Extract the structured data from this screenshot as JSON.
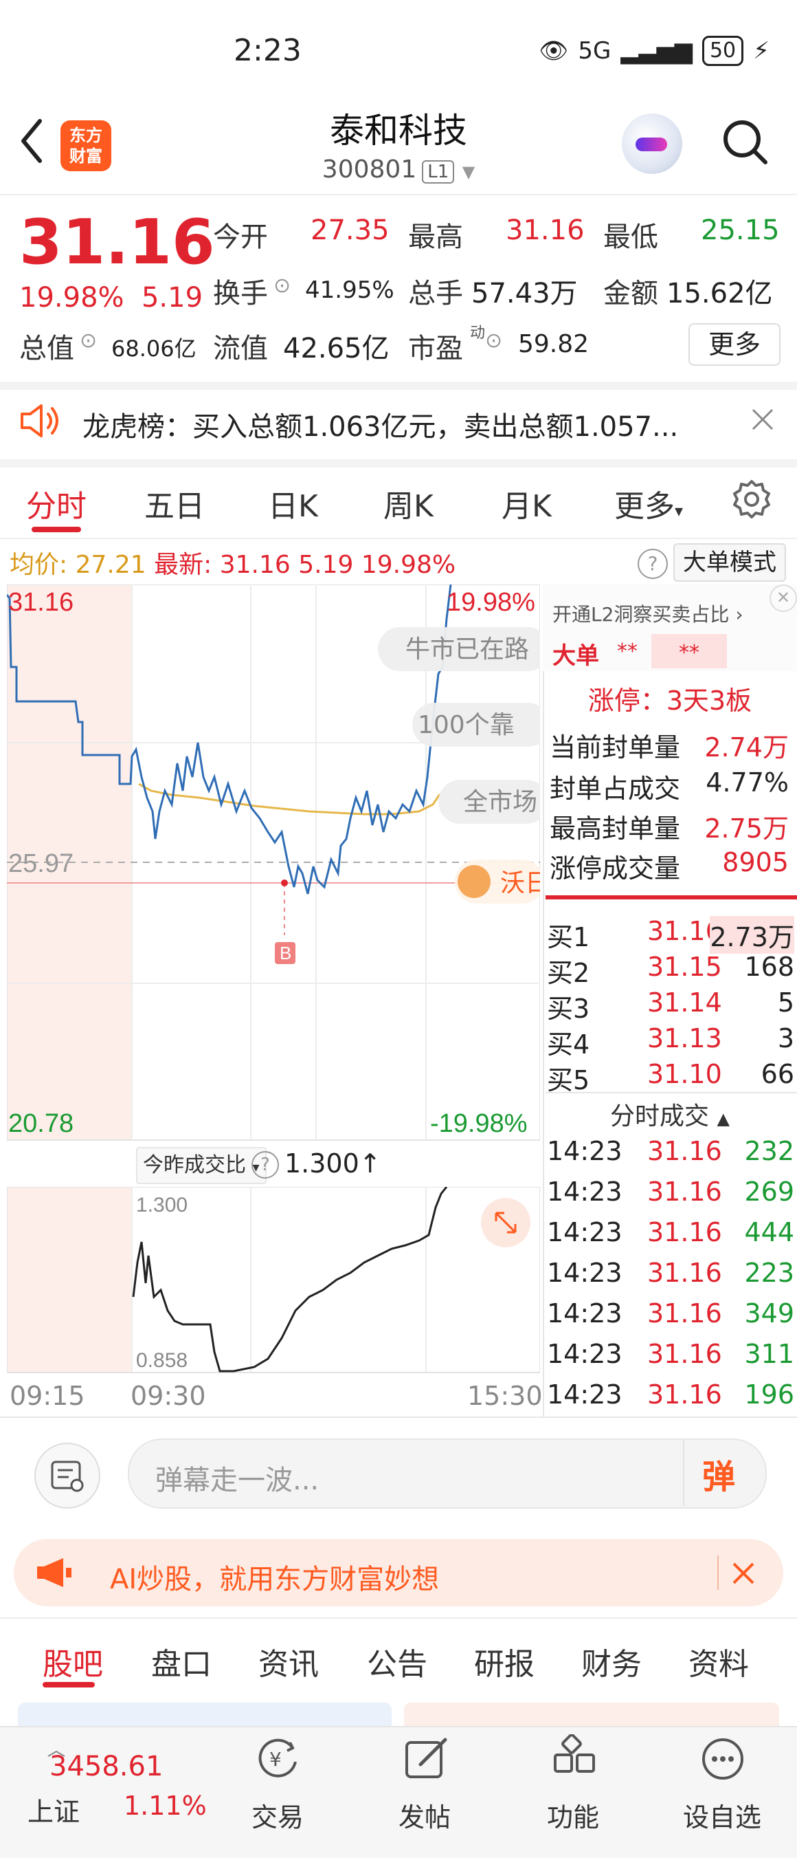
{
  "status_bar": {
    "time": "2:23",
    "signal": "5G",
    "battery": "50"
  },
  "header": {
    "logo_line1": "东方",
    "logo_line2": "财富",
    "stock_name": "泰和科技",
    "stock_code": "300801",
    "level_badge": "L1"
  },
  "quote": {
    "price": "31.16",
    "change_pct": "19.98%",
    "change_amt": "5.19",
    "open_label": "今开",
    "open_value": "27.35",
    "high_label": "最高",
    "high_value": "31.16",
    "low_label": "最低",
    "low_value": "25.15",
    "turnover_label": "换手",
    "turnover_value": "41.95%",
    "volume_label": "总手",
    "volume_value": "57.43万",
    "amount_label": "金额",
    "amount_value": "15.62亿",
    "mcap_label": "总值",
    "mcap_value": "68.06亿",
    "float_label": "流值",
    "float_value": "42.65亿",
    "pe_label": "市盈",
    "pe_sup": "动",
    "pe_value": "59.82",
    "more_label": "更多"
  },
  "notice": {
    "text": "龙虎榜：买入总额1.063亿元，卖出总额1.057..."
  },
  "chart_tabs": [
    "分时",
    "五日",
    "日K",
    "周K",
    "月K",
    "更多"
  ],
  "info_row": {
    "avg_label": "均价:",
    "avg_value": "27.21",
    "latest_label": "最新:",
    "latest_value": "31.16",
    "latest_chg": "5.19",
    "latest_pct": "19.98%",
    "big_order_mode": "大单模式"
  },
  "intraday": {
    "top_price": "31.16",
    "top_pct": "19.98%",
    "prev_close": "25.97",
    "bottom_price": "20.78",
    "bottom_pct": "-19.98%",
    "b_marker": "B",
    "floating_msgs": [
      "牛市已在路",
      "100个靠",
      "全市场",
      "沃日"
    ],
    "indicator_label": "今昨成交比",
    "indicator_value": "1.300↑",
    "ind_top": "1.300",
    "ind_bottom": "0.858",
    "time_labels": [
      "09:15",
      "09:30",
      "15:30"
    ]
  },
  "orderbook": {
    "l2_promo": "开通L2洞察买卖占比",
    "big_order_label": "大单",
    "masked_a": "**",
    "masked_b": "**",
    "limit_title": "涨停：3天3板",
    "stats": [
      {
        "label": "当前封单量",
        "value": "2.74万"
      },
      {
        "label": "封单占成交",
        "value": "4.77%"
      },
      {
        "label": "最高封单量",
        "value": "2.75万"
      },
      {
        "label": "涨停成交量",
        "value": "8905"
      }
    ],
    "bids": [
      {
        "label": "买1",
        "price": "31.16",
        "vol": "2.73万"
      },
      {
        "label": "买2",
        "price": "31.15",
        "vol": "168"
      },
      {
        "label": "买3",
        "price": "31.14",
        "vol": "5"
      },
      {
        "label": "买4",
        "price": "31.13",
        "vol": "3"
      },
      {
        "label": "买5",
        "price": "31.10",
        "vol": "66"
      }
    ],
    "trades_title": "分时成交",
    "trades": [
      {
        "time": "14:23",
        "price": "31.16",
        "vol": "232"
      },
      {
        "time": "14:23",
        "price": "31.16",
        "vol": "269"
      },
      {
        "time": "14:23",
        "price": "31.16",
        "vol": "444"
      },
      {
        "time": "14:23",
        "price": "31.16",
        "vol": "223"
      },
      {
        "time": "14:23",
        "price": "31.16",
        "vol": "349"
      },
      {
        "time": "14:23",
        "price": "31.16",
        "vol": "311"
      },
      {
        "time": "14:23",
        "price": "31.16",
        "vol": "196"
      }
    ]
  },
  "comment": {
    "placeholder": "弹幕走一波...",
    "send_label": "弹"
  },
  "ai_banner": {
    "text": "AI炒股，就用东方财富妙想"
  },
  "bottom_tabs": [
    "股吧",
    "盘口",
    "资讯",
    "公告",
    "研报",
    "财务",
    "资料"
  ],
  "bottom_nav": {
    "index_value": "3458.61",
    "index_name": "上证",
    "index_pct": "1.11%",
    "items": [
      "交易",
      "发帖",
      "功能",
      "设自选"
    ]
  },
  "colors": {
    "up": "#e0242f",
    "down": "#1a9a32",
    "accent": "#ff5a1f",
    "price_line": "#2f6db5",
    "avg_line": "#e6b74a"
  }
}
